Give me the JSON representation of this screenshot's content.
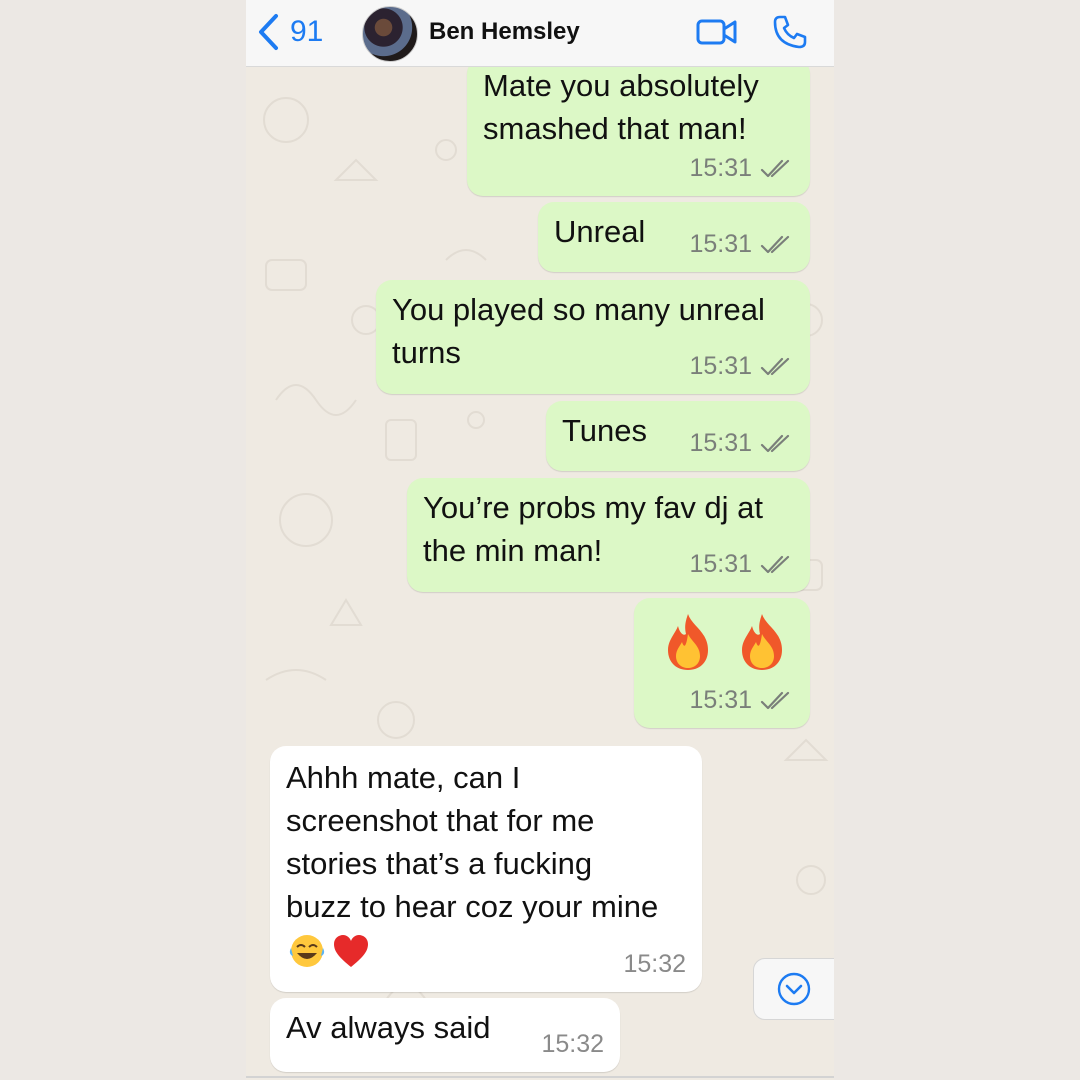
{
  "header": {
    "back_count": "91",
    "contact_name": "Ben Hemsley"
  },
  "messages": [
    {
      "direction": "out",
      "text": "Mate you absolutely\nsmashed that man!",
      "time": "15:31",
      "status": "read"
    },
    {
      "direction": "out",
      "text": "Unreal",
      "time": "15:31",
      "status": "read"
    },
    {
      "direction": "out",
      "text": "You played so many unreal\nturns",
      "time": "15:31",
      "status": "read"
    },
    {
      "direction": "out",
      "text": "Tunes",
      "time": "15:31",
      "status": "read"
    },
    {
      "direction": "out",
      "text": "You’re probs my fav dj at\nthe min man!",
      "time": "15:31",
      "status": "read"
    },
    {
      "direction": "out",
      "text": "",
      "emoji": [
        "fire-emoji",
        "fire-emoji"
      ],
      "time": "15:31",
      "status": "read"
    },
    {
      "direction": "in",
      "text": "Ahhh mate, can I\nscreenshot that for me\nstories that’s a fucking\nbuzz to hear coz your mine",
      "emoji": [
        "tears-of-joy-emoji",
        "red-heart-emoji"
      ],
      "time": "15:32"
    },
    {
      "direction": "in",
      "text": "Av always said",
      "time": "15:32"
    }
  ],
  "colors": {
    "accent": "#1D7BF2",
    "outgoing_bubble": "#DCF8C6",
    "incoming_bubble": "#FFFFFF",
    "chat_background": "#EFEAE2"
  },
  "icons": [
    "chevron-left-icon",
    "video-camera-icon",
    "phone-icon",
    "double-check-icon",
    "chevron-down-circle-icon"
  ]
}
